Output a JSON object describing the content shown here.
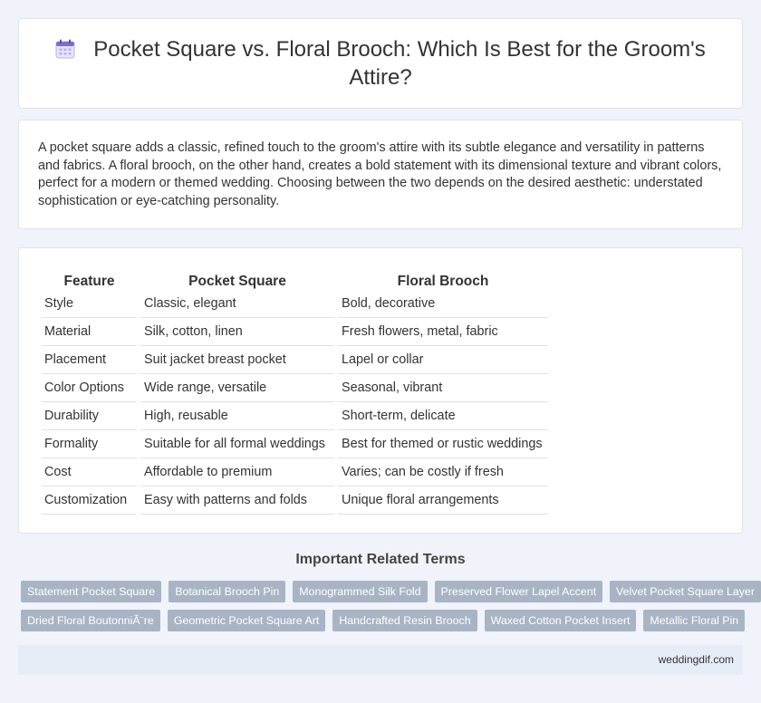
{
  "header": {
    "title": "Pocket Square vs. Floral Brooch: Which Is Best for the Groom's Attire?"
  },
  "intro": {
    "text": "A pocket square adds a classic, refined touch to the groom's attire with its subtle elegance and versatility in patterns and fabrics. A floral brooch, on the other hand, creates a bold statement with its dimensional texture and vibrant colors, perfect for a modern or themed wedding. Choosing between the two depends on the desired aesthetic: understated sophistication or eye-catching personality."
  },
  "table": {
    "headers": [
      "Feature",
      "Pocket Square",
      "Floral Brooch"
    ],
    "rows": [
      [
        "Style",
        "Classic, elegant",
        "Bold, decorative"
      ],
      [
        "Material",
        "Silk, cotton, linen",
        "Fresh flowers, metal, fabric"
      ],
      [
        "Placement",
        "Suit jacket breast pocket",
        "Lapel or collar"
      ],
      [
        "Color Options",
        "Wide range, versatile",
        "Seasonal, vibrant"
      ],
      [
        "Durability",
        "High, reusable",
        "Short-term, delicate"
      ],
      [
        "Formality",
        "Suitable for all formal weddings",
        "Best for themed or rustic weddings"
      ],
      [
        "Cost",
        "Affordable to premium",
        "Varies; can be costly if fresh"
      ],
      [
        "Customization",
        "Easy with patterns and folds",
        "Unique floral arrangements"
      ]
    ]
  },
  "related": {
    "title": "Important Related Terms",
    "row1": [
      "Statement Pocket Square",
      "Botanical Brooch Pin",
      "Monogrammed Silk Fold",
      "Preserved Flower Lapel Accent",
      "Velvet Pocket Square Layer"
    ],
    "row2": [
      "Dried Floral BoutonniÃ¨re",
      "Geometric Pocket Square Art",
      "Handcrafted Resin Brooch",
      "Waxed Cotton Pocket Insert",
      "Metallic Floral Pin"
    ]
  },
  "footer": {
    "site": "weddingdif.com"
  },
  "colors": {
    "background": "#f0f3f9",
    "tag_bg": "#a8b4c4",
    "footer_bg": "#e6ecf6",
    "icon_accent": "#7b6fd6"
  }
}
